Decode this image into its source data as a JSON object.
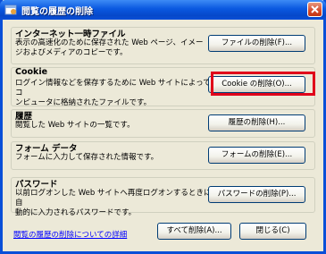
{
  "window": {
    "title": "閲覧の履歴の削除"
  },
  "sections": [
    {
      "title": "インターネット一時ファイル",
      "desc_lines": [
        "表示の高速化のために保存された Web ページ、イメー",
        "ジおよびメディアのコピーです。"
      ],
      "button": "ファイルの削除(F)..."
    },
    {
      "title": "Cookie",
      "desc_lines": [
        "ログイン情報などを保存するために Web サイトによってコ",
        "ンピュータに格納されたファイルです。"
      ],
      "button": "Cookie の削除(O)..."
    },
    {
      "title": "履歴",
      "desc_lines": [
        "閲覧した Web サイトの一覧です。"
      ],
      "button": "履歴の削除(H)..."
    },
    {
      "title": "フォーム データ",
      "desc_lines": [
        "フォームに入力して保存された情報です。"
      ],
      "button": "フォームの削除(E)..."
    },
    {
      "title": "パスワード",
      "desc_lines": [
        "以前ログオンした Web サイトへ再度ログオンするときに自",
        "動的に入力されるパスワードです。"
      ],
      "button": "パスワードの削除(P)..."
    }
  ],
  "footer": {
    "link": "閲覧の履歴の削除についての詳細",
    "delete_all": "すべて削除(A)...",
    "close": "閉じる(C)"
  },
  "colors": {
    "highlight": "#e0001a",
    "title_bar": "#0a58e0"
  }
}
